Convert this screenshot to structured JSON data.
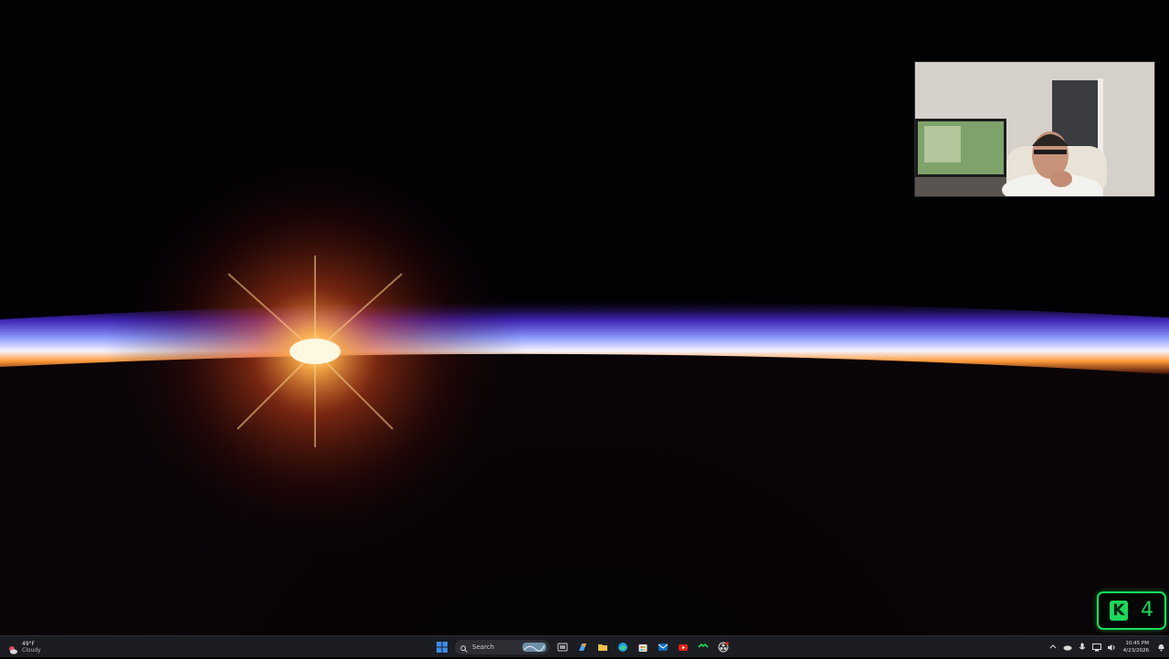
{
  "wallpaper": {
    "subject": "earth-horizon-sunrise",
    "colors": {
      "space": "#020205",
      "atmosphere_blue": "#6f7cff",
      "atmosphere_violet": "#5a2cd8",
      "horizon_white": "#f6f4ff",
      "horizon_orange": "#ff7a1a",
      "sun": "#fff6d8"
    }
  },
  "webcam": {
    "visible": true
  },
  "badge": {
    "logo_letter": "K",
    "count": "4",
    "color": "#1bd85a"
  },
  "taskbar": {
    "weather": {
      "temperature": "49°F",
      "condition": "Cloudy"
    },
    "search": {
      "placeholder": "Search"
    },
    "apps": [
      {
        "name": "start",
        "icon": "windows-logo-icon"
      },
      {
        "name": "search",
        "icon": "search-icon"
      },
      {
        "name": "task-view",
        "icon": "task-view-icon"
      },
      {
        "name": "copilot",
        "icon": "copilot-icon"
      },
      {
        "name": "file-explorer",
        "icon": "folder-icon"
      },
      {
        "name": "edge",
        "icon": "edge-icon"
      },
      {
        "name": "store",
        "icon": "store-icon"
      },
      {
        "name": "outlook",
        "icon": "outlook-icon"
      },
      {
        "name": "youtube",
        "icon": "youtube-icon"
      },
      {
        "name": "kick",
        "icon": "kick-icon"
      },
      {
        "name": "obs",
        "icon": "obs-icon"
      }
    ],
    "tray": {
      "time": "10:45 PM",
      "date": "4/23/2026"
    },
    "colors": {
      "bar": "#1c1d22",
      "accent": "#3b8eea"
    }
  }
}
